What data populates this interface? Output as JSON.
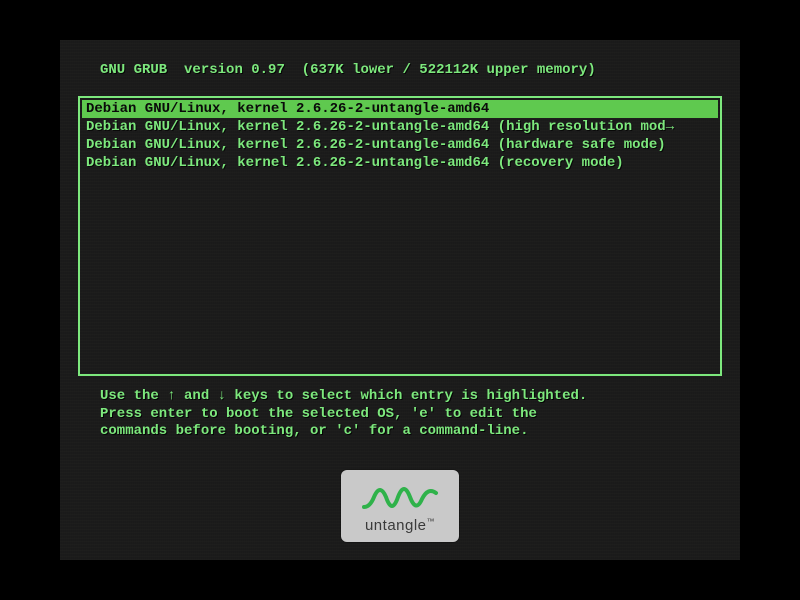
{
  "header": {
    "title": "GNU GRUB",
    "version_label": "version 0.97",
    "memory": "(637K lower / 522112K upper memory)"
  },
  "menu": {
    "selected_index": 0,
    "entries": [
      "Debian GNU/Linux, kernel 2.6.26-2-untangle-amd64",
      "Debian GNU/Linux, kernel 2.6.26-2-untangle-amd64 (high resolution mod→",
      "Debian GNU/Linux, kernel 2.6.26-2-untangle-amd64 (hardware safe mode)",
      "Debian GNU/Linux, kernel 2.6.26-2-untangle-amd64 (recovery mode)"
    ]
  },
  "hint": {
    "line1": "Use the ↑ and ↓ keys to select which entry is highlighted.",
    "line2": "Press enter to boot the selected OS, 'e' to edit the",
    "line3": "commands before booting, or 'c' for a command-line."
  },
  "logo": {
    "text": "untangle",
    "tm": "™"
  },
  "colors": {
    "text": "#7de87d",
    "highlight_bg": "#5fc94f",
    "highlight_fg": "#0a0a0a",
    "logo_bg": "#c9c9c9",
    "logo_wave": "#2fb24a"
  }
}
